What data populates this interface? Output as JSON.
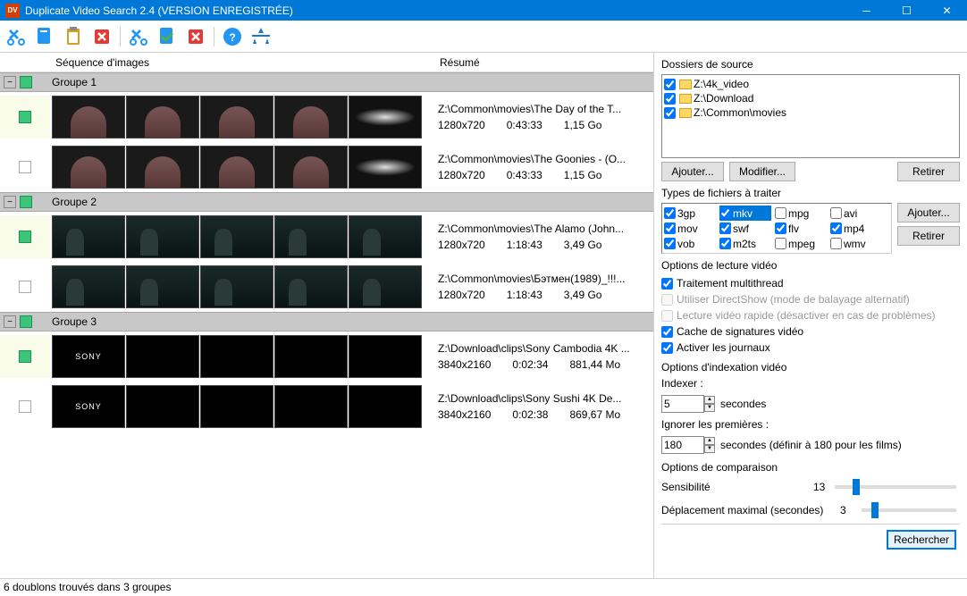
{
  "window": {
    "title": "Duplicate Video Search 2.4 (VERSION ENREGISTRÉE)"
  },
  "columns": {
    "seq": "Séquence d'images",
    "resume": "Résumé"
  },
  "groups": [
    {
      "name": "Groupe 1",
      "videos": [
        {
          "checked": true,
          "thumb_style": "man_galaxy",
          "path": "Z:\\Common\\movies\\The Day of the T...",
          "res": "1280x720",
          "dur": "0:43:33",
          "size": "1,15 Go"
        },
        {
          "checked": false,
          "thumb_style": "man_galaxy",
          "path": "Z:\\Common\\movies\\The Goonies - (O...",
          "res": "1280x720",
          "dur": "0:43:33",
          "size": "1,15 Go"
        }
      ]
    },
    {
      "name": "Groupe 2",
      "videos": [
        {
          "checked": true,
          "thumb_style": "forest",
          "path": "Z:\\Common\\movies\\The Alamo (John...",
          "res": "1280x720",
          "dur": "1:18:43",
          "size": "3,49 Go"
        },
        {
          "checked": false,
          "thumb_style": "forest",
          "path": "Z:\\Common\\movies\\Бэтмен(1989)_!!!...",
          "res": "1280x720",
          "dur": "1:18:43",
          "size": "3,49 Go"
        }
      ]
    },
    {
      "name": "Groupe 3",
      "videos": [
        {
          "checked": true,
          "thumb_style": "sony",
          "path": "Z:\\Download\\clips\\Sony Cambodia 4K ...",
          "res": "3840x2160",
          "dur": "0:02:34",
          "size": "881,44 Mo"
        },
        {
          "checked": false,
          "thumb_style": "sony",
          "path": "Z:\\Download\\clips\\Sony Sushi 4K De...",
          "res": "3840x2160",
          "dur": "0:02:38",
          "size": "869,67 Mo"
        }
      ]
    }
  ],
  "side": {
    "folders_title": "Dossiers de source",
    "folders": [
      "Z:\\4k_video",
      "Z:\\Download",
      "Z:\\Common\\movies"
    ],
    "btn_add": "Ajouter...",
    "btn_edit": "Modifier...",
    "btn_remove": "Retirer",
    "types_title": "Types de fichiers à traiter",
    "types": [
      {
        "label": "3gp",
        "checked": true,
        "sel": false
      },
      {
        "label": "mkv",
        "checked": true,
        "sel": true
      },
      {
        "label": "mpg",
        "checked": false,
        "sel": false
      },
      {
        "label": "avi",
        "checked": false,
        "sel": false
      },
      {
        "label": "mov",
        "checked": true,
        "sel": false
      },
      {
        "label": "swf",
        "checked": true,
        "sel": false
      },
      {
        "label": "flv",
        "checked": true,
        "sel": false
      },
      {
        "label": "mp4",
        "checked": true,
        "sel": false
      },
      {
        "label": "vob",
        "checked": true,
        "sel": false
      },
      {
        "label": "m2ts",
        "checked": true,
        "sel": false
      },
      {
        "label": "mpeg",
        "checked": false,
        "sel": false
      },
      {
        "label": "wmv",
        "checked": false,
        "sel": false
      }
    ],
    "read_title": "Options de lecture vidéo",
    "read_opts": [
      {
        "label": "Traitement multithread",
        "checked": true,
        "disabled": false
      },
      {
        "label": "Utiliser DirectShow (mode de balayage alternatif)",
        "checked": false,
        "disabled": true
      },
      {
        "label": "Lecture vidéo rapide (désactiver en cas de problèmes)",
        "checked": false,
        "disabled": true
      },
      {
        "label": "Cache de signatures vidéo",
        "checked": true,
        "disabled": false
      },
      {
        "label": "Activer les journaux",
        "checked": true,
        "disabled": false
      }
    ],
    "index_title": "Options d'indexation vidéo",
    "indexer_label": "Indexer :",
    "indexer_value": "5",
    "indexer_unit": "secondes",
    "ignore_label": "Ignorer les premières :",
    "ignore_value": "180",
    "ignore_unit": "secondes (définir à 180 pour les films)",
    "compare_title": "Options de comparaison",
    "sens_label": "Sensibilité",
    "sens_value": "13",
    "shift_label": "Déplacement maximal (secondes)",
    "shift_value": "3",
    "search_btn": "Rechercher"
  },
  "status": "6 doublons trouvés dans 3 groupes"
}
